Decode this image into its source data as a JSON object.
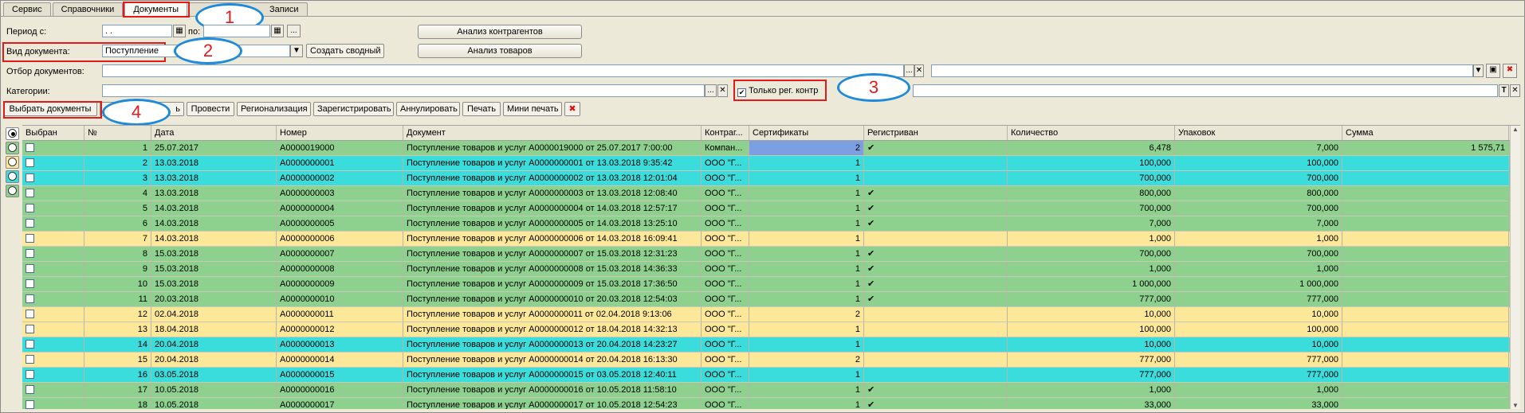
{
  "tabs": [
    "Сервис",
    "Справочники",
    "Документы",
    "Записи"
  ],
  "annotations": [
    "1",
    "2",
    "3",
    "4"
  ],
  "form": {
    "period_from_label": "Период с:",
    "period_from_value": ". .",
    "period_to_label": "по:",
    "doc_type_label": "Вид документа:",
    "doc_type_value": "Поступление",
    "create_summary_button": "Создать сводный",
    "analysis_contractors_button": "Анализ контрагентов",
    "analysis_goods_button": "Анализ товаров",
    "doc_filter_label": "Отбор документов:",
    "categories_label": "Категории:",
    "only_reg_label": "Только рег. контр",
    "ellipsis": "...",
    "clear": "✕",
    "t_btn": "T"
  },
  "toolbar": {
    "select_docs": "Выбрать документы",
    "hidden_tail": "ь",
    "post": "Провести",
    "regionalize": "Регионализация",
    "register": "Зарегистрировать",
    "annul": "Аннулировать",
    "print": "Печать",
    "mini_print": "Мини печать"
  },
  "grid": {
    "columns": [
      "Выбран",
      "№",
      "Дата",
      "Номер",
      "Документ",
      "Контраг...",
      "Сертификаты",
      "Регистриван",
      "Количество",
      "Упаковок",
      "Сумма"
    ],
    "rows": [
      {
        "n": "1",
        "date": "25.07.2017",
        "num": "А0000019000",
        "doc": "Поступление товаров и услуг А0000019000 от 25.07.2017 7:00:00",
        "contr": "Компан...",
        "cert": "2",
        "reg": "✔",
        "qty": "6,478",
        "pack": "7,000",
        "sum": "1 575,71",
        "color": "green"
      },
      {
        "n": "2",
        "date": "13.03.2018",
        "num": "А0000000001",
        "doc": "Поступление товаров и услуг А0000000001 от 13.03.2018 9:35:42",
        "contr": "ООО \"Г...",
        "cert": "1",
        "reg": "",
        "qty": "100,000",
        "pack": "100,000",
        "sum": "",
        "color": "cyan"
      },
      {
        "n": "3",
        "date": "13.03.2018",
        "num": "А0000000002",
        "doc": "Поступление товаров и услуг А0000000002 от 13.03.2018 12:01:04",
        "contr": "ООО \"Г...",
        "cert": "1",
        "reg": "",
        "qty": "700,000",
        "pack": "700,000",
        "sum": "",
        "color": "cyan"
      },
      {
        "n": "4",
        "date": "13.03.2018",
        "num": "А0000000003",
        "doc": "Поступление товаров и услуг А0000000003 от 13.03.2018 12:08:40",
        "contr": "ООО \"Г...",
        "cert": "1",
        "reg": "✔",
        "qty": "800,000",
        "pack": "800,000",
        "sum": "",
        "color": "green"
      },
      {
        "n": "5",
        "date": "14.03.2018",
        "num": "А0000000004",
        "doc": "Поступление товаров и услуг А0000000004 от 14.03.2018 12:57:17",
        "contr": "ООО \"Г...",
        "cert": "1",
        "reg": "✔",
        "qty": "700,000",
        "pack": "700,000",
        "sum": "",
        "color": "green"
      },
      {
        "n": "6",
        "date": "14.03.2018",
        "num": "А0000000005",
        "doc": "Поступление товаров и услуг А0000000005 от 14.03.2018 13:25:10",
        "contr": "ООО \"Г...",
        "cert": "1",
        "reg": "✔",
        "qty": "7,000",
        "pack": "7,000",
        "sum": "",
        "color": "green"
      },
      {
        "n": "7",
        "date": "14.03.2018",
        "num": "А0000000006",
        "doc": "Поступление товаров и услуг А0000000006 от 14.03.2018 16:09:41",
        "contr": "ООО \"Г...",
        "cert": "1",
        "reg": "",
        "qty": "1,000",
        "pack": "1,000",
        "sum": "",
        "color": "yellow"
      },
      {
        "n": "8",
        "date": "15.03.2018",
        "num": "А0000000007",
        "doc": "Поступление товаров и услуг А0000000007 от 15.03.2018 12:31:23",
        "contr": "ООО \"Г...",
        "cert": "1",
        "reg": "✔",
        "qty": "700,000",
        "pack": "700,000",
        "sum": "",
        "color": "green"
      },
      {
        "n": "9",
        "date": "15.03.2018",
        "num": "А0000000008",
        "doc": "Поступление товаров и услуг А0000000008 от 15.03.2018 14:36:33",
        "contr": "ООО \"Г...",
        "cert": "1",
        "reg": "✔",
        "qty": "1,000",
        "pack": "1,000",
        "sum": "",
        "color": "green"
      },
      {
        "n": "10",
        "date": "15.03.2018",
        "num": "А0000000009",
        "doc": "Поступление товаров и услуг А0000000009 от 15.03.2018 17:36:50",
        "contr": "ООО \"Г...",
        "cert": "1",
        "reg": "✔",
        "qty": "1 000,000",
        "pack": "1 000,000",
        "sum": "",
        "color": "green"
      },
      {
        "n": "11",
        "date": "20.03.2018",
        "num": "А0000000010",
        "doc": "Поступление товаров и услуг А0000000010 от 20.03.2018 12:54:03",
        "contr": "ООО \"Г...",
        "cert": "1",
        "reg": "✔",
        "qty": "777,000",
        "pack": "777,000",
        "sum": "",
        "color": "green"
      },
      {
        "n": "12",
        "date": "02.04.2018",
        "num": "А0000000011",
        "doc": "Поступление товаров и услуг А0000000011 от 02.04.2018 9:13:06",
        "contr": "ООО \"Г...",
        "cert": "2",
        "reg": "",
        "qty": "10,000",
        "pack": "10,000",
        "sum": "",
        "color": "yellow"
      },
      {
        "n": "13",
        "date": "18.04.2018",
        "num": "А0000000012",
        "doc": "Поступление товаров и услуг А0000000012 от 18.04.2018 14:32:13",
        "contr": "ООО \"Г...",
        "cert": "1",
        "reg": "",
        "qty": "100,000",
        "pack": "100,000",
        "sum": "",
        "color": "yellow"
      },
      {
        "n": "14",
        "date": "20.04.2018",
        "num": "А0000000013",
        "doc": "Поступление товаров и услуг А0000000013 от 20.04.2018 14:23:27",
        "contr": "ООО \"Г...",
        "cert": "1",
        "reg": "",
        "qty": "10,000",
        "pack": "10,000",
        "sum": "",
        "color": "cyan"
      },
      {
        "n": "15",
        "date": "20.04.2018",
        "num": "А0000000014",
        "doc": "Поступление товаров и услуг А0000000014 от 20.04.2018 16:13:30",
        "contr": "ООО \"Г...",
        "cert": "2",
        "reg": "",
        "qty": "777,000",
        "pack": "777,000",
        "sum": "",
        "color": "yellow"
      },
      {
        "n": "16",
        "date": "03.05.2018",
        "num": "А0000000015",
        "doc": "Поступление товаров и услуг А0000000015 от 03.05.2018 12:40:11",
        "contr": "ООО \"Г...",
        "cert": "1",
        "reg": "",
        "qty": "777,000",
        "pack": "777,000",
        "sum": "",
        "color": "cyan"
      },
      {
        "n": "17",
        "date": "10.05.2018",
        "num": "А0000000016",
        "doc": "Поступление товаров и услуг А0000000016 от 10.05.2018 11:58:10",
        "contr": "ООО \"Г...",
        "cert": "1",
        "reg": "✔",
        "qty": "1,000",
        "pack": "1,000",
        "sum": "",
        "color": "green"
      },
      {
        "n": "18",
        "date": "10.05.2018",
        "num": "А0000000017",
        "doc": "Поступление товаров и услуг А0000000017 от 10.05.2018 12:54:23",
        "contr": "ООО \"Г...",
        "cert": "1",
        "reg": "✔",
        "qty": "33,000",
        "pack": "33,000",
        "sum": "",
        "color": "green"
      }
    ]
  }
}
